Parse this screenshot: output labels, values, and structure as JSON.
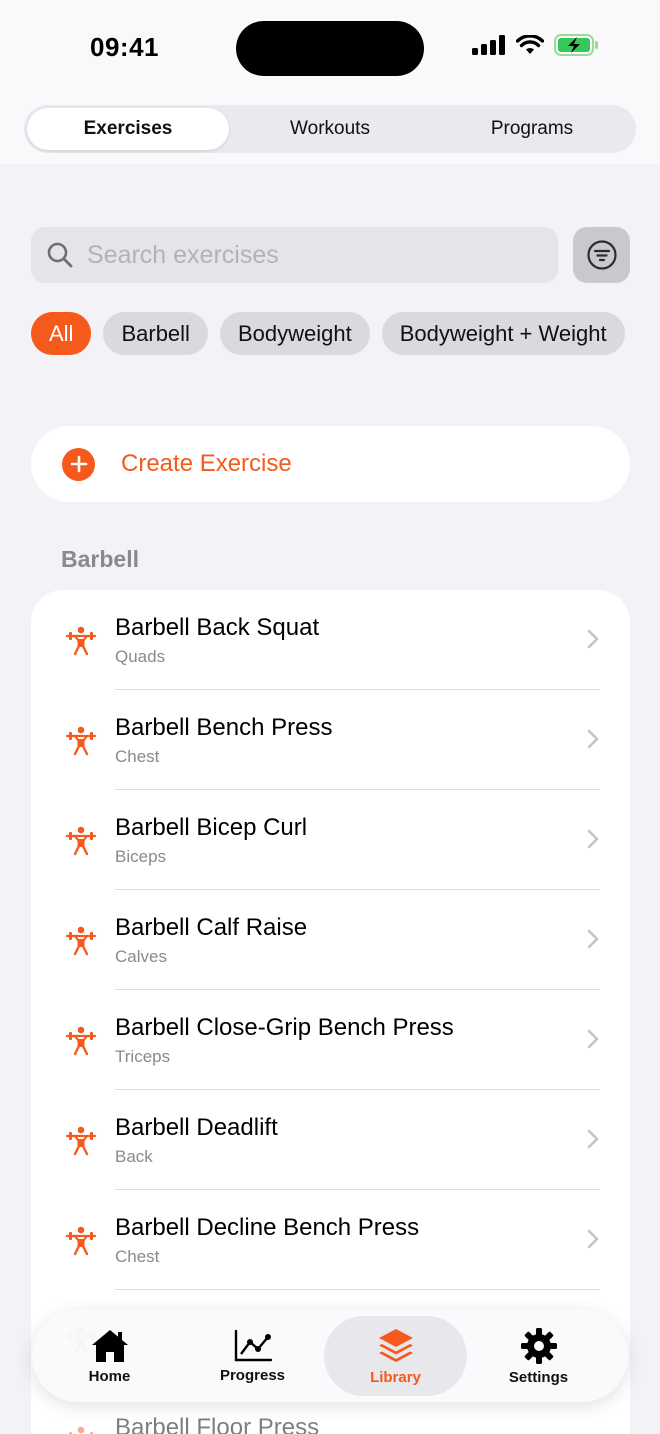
{
  "status_bar": {
    "time": "09:41"
  },
  "segments": [
    {
      "label": "Exercises",
      "active": true
    },
    {
      "label": "Workouts",
      "active": false
    },
    {
      "label": "Programs",
      "active": false
    }
  ],
  "search": {
    "placeholder": "Search exercises",
    "value": ""
  },
  "filter_chips": [
    {
      "label": "All",
      "active": true
    },
    {
      "label": "Barbell",
      "active": false
    },
    {
      "label": "Bodyweight",
      "active": false
    },
    {
      "label": "Bodyweight + Weight",
      "active": false
    }
  ],
  "create_button": {
    "label": "Create Exercise",
    "icon": "plus-circle-icon"
  },
  "section": {
    "title": "Barbell"
  },
  "exercises": [
    {
      "name": "Barbell Back Squat",
      "muscle": "Quads"
    },
    {
      "name": "Barbell Bench Press",
      "muscle": "Chest"
    },
    {
      "name": "Barbell Bicep Curl",
      "muscle": "Biceps"
    },
    {
      "name": "Barbell Calf Raise",
      "muscle": "Calves"
    },
    {
      "name": "Barbell Close-Grip Bench Press",
      "muscle": "Triceps"
    },
    {
      "name": "Barbell Deadlift",
      "muscle": "Back"
    },
    {
      "name": "Barbell Decline Bench Press",
      "muscle": "Chest"
    },
    {
      "name": "",
      "muscle": ""
    },
    {
      "name": "Barbell Floor Press",
      "muscle": ""
    }
  ],
  "tab_bar": [
    {
      "label": "Home",
      "icon": "home-icon",
      "active": false
    },
    {
      "label": "Progress",
      "icon": "chart-icon",
      "active": false
    },
    {
      "label": "Library",
      "icon": "stack-icon",
      "active": true
    },
    {
      "label": "Settings",
      "icon": "gear-icon",
      "active": false
    }
  ],
  "colors": {
    "accent": "#f5591c",
    "background": "#f2f2f7"
  }
}
